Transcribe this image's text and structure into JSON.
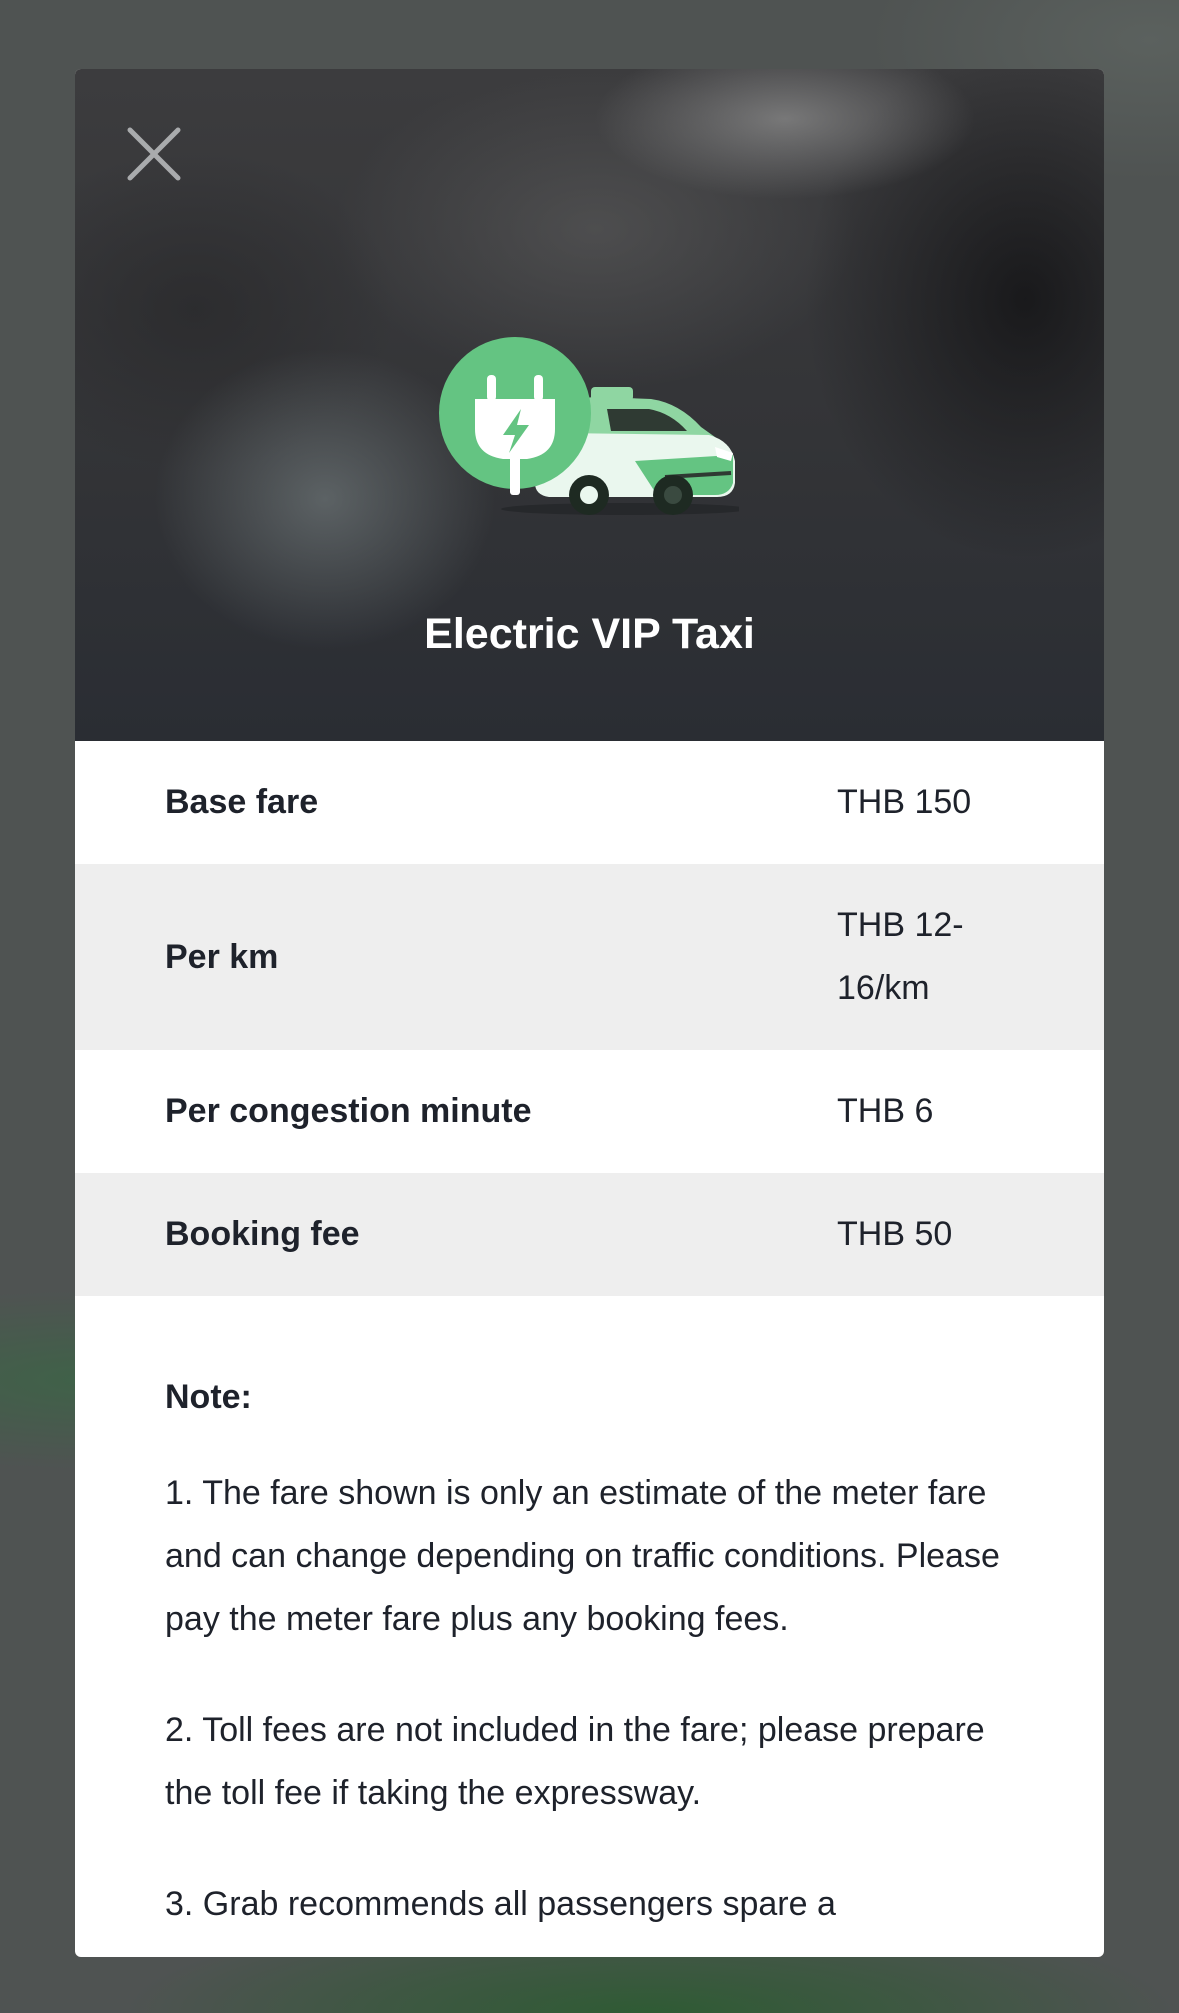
{
  "modal": {
    "title": "Electric VIP Taxi",
    "icon": "electric-taxi-icon",
    "close_icon": "close-icon"
  },
  "fares": [
    {
      "label": "Base fare",
      "value": "THB 150"
    },
    {
      "label": "Per km",
      "value": "THB 12-16/km"
    },
    {
      "label": "Per congestion minute",
      "value": "THB 6"
    },
    {
      "label": "Booking fee",
      "value": "THB 50"
    }
  ],
  "notes": {
    "heading": "Note:",
    "items": [
      "1. The fare shown is only an estimate of the meter fare and can change depending on traffic conditions. Please pay the meter fare plus any booking fees.",
      "2. Toll fees are not included in the fare; please prepare the toll fee if taking the expressway.",
      "3. Grab recommends all passengers spare a"
    ]
  },
  "colors": {
    "accent_green": "#64c482",
    "light_green": "#8fd6a2",
    "text_dark": "#1e222b",
    "row_alt": "#eeeeee"
  }
}
